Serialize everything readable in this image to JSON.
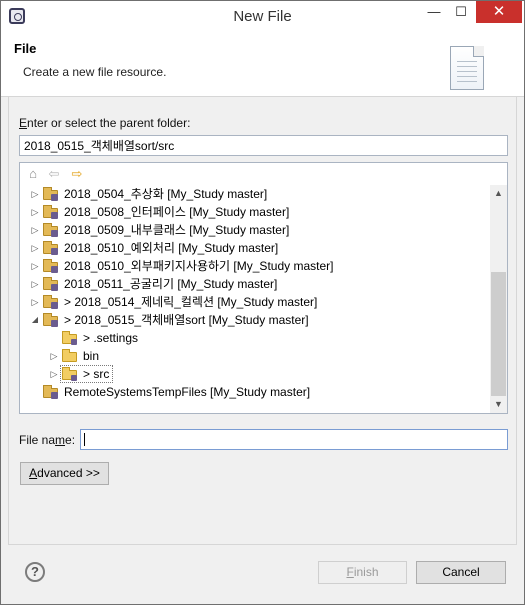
{
  "window": {
    "title": "New File",
    "min_glyph": "—",
    "max_glyph": "☐",
    "close_glyph": "✕"
  },
  "header": {
    "title": "File",
    "description": "Create a new file resource."
  },
  "parent_folder": {
    "label_prefix": "E",
    "label_rest": "nter or select the parent folder:",
    "value": "2018_0515_객체배열sort/src"
  },
  "tree": {
    "toolbar": {
      "home_glyph": "⌂",
      "back_glyph": "⇦",
      "forward_glyph": "⇨"
    },
    "items": [
      {
        "label": "2018_0504_추상화 [My_Study master]",
        "twisty": "▷",
        "icon": "project-folder-icon"
      },
      {
        "label": "2018_0508_인터페이스 [My_Study master]",
        "twisty": "▷",
        "icon": "project-folder-icon"
      },
      {
        "label": "2018_0509_내부클래스 [My_Study master]",
        "twisty": "▷",
        "icon": "project-folder-icon"
      },
      {
        "label": "2018_0510_예외처리 [My_Study master]",
        "twisty": "▷",
        "icon": "project-folder-icon"
      },
      {
        "label": "2018_0510_외부패키지사용하기 [My_Study master]",
        "twisty": "▷",
        "icon": "project-folder-icon"
      },
      {
        "label": "2018_0511_공굴리기 [My_Study master]",
        "twisty": "▷",
        "icon": "project-folder-icon"
      },
      {
        "label": "> 2018_0514_제네릭_컬렉션 [My_Study master]",
        "twisty": "▷",
        "icon": "project-folder-icon"
      },
      {
        "label": "> 2018_0515_객체배열sort [My_Study master]",
        "twisty": "◢",
        "icon": "project-folder-icon"
      },
      {
        "label": "> .settings",
        "twisty": "",
        "icon": "folder-icon"
      },
      {
        "label": "bin",
        "twisty": "▷",
        "icon": "folder-icon"
      },
      {
        "label": "> src",
        "twisty": "▷",
        "icon": "folder-icon"
      },
      {
        "label": "RemoteSystemsTempFiles [My_Study master]",
        "twisty": "",
        "icon": "project-folder-icon"
      }
    ],
    "scroll_up_glyph": "▲",
    "scroll_down_glyph": "▼"
  },
  "file_name": {
    "label_a": "File na",
    "label_u": "m",
    "label_b": "e:",
    "value": ""
  },
  "buttons": {
    "advanced_u": "A",
    "advanced_rest": "dvanced >>",
    "finish_u": "F",
    "finish_rest": "inish",
    "cancel": "Cancel",
    "help_glyph": "?"
  }
}
